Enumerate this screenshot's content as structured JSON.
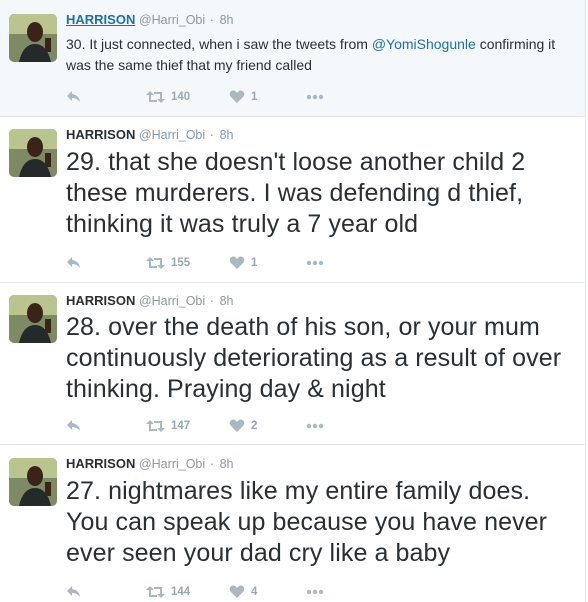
{
  "colors": {
    "accent": "#1b6fb0",
    "muted": "#8899a6",
    "icon": "#aab8c2",
    "border": "#e1e8ed"
  },
  "icons": {
    "reply": "reply-icon",
    "retweet": "retweet-icon",
    "like": "heart-icon",
    "more": "more-icon"
  },
  "tweets": [
    {
      "name": "HARRISON",
      "handle": "@Harri_Obi",
      "sep": "·",
      "time": "8h",
      "text_before": "30. It just connected, when i saw the tweets from ",
      "mention": "@YomiShogunle",
      "text_after": " confirming it was the same thief that my friend called",
      "retweets": "140",
      "likes": "1"
    },
    {
      "name": "HARRISON",
      "handle": "@Harri_Obi",
      "sep": "·",
      "time": "8h",
      "text": "29. that she doesn't loose another child 2 these murderers. I was defending d thief, thinking it was truly a 7 year old",
      "retweets": "155",
      "likes": "1"
    },
    {
      "name": "HARRISON",
      "handle": "@Harri_Obi",
      "sep": "·",
      "time": "8h",
      "text": "28. over the death of his son, or your mum continuously deteriorating as a result of over thinking. Praying day & night",
      "retweets": "147",
      "likes": "2"
    },
    {
      "name": "HARRISON",
      "handle": "@Harri_Obi",
      "sep": "·",
      "time": "8h",
      "text": "27. nightmares like my entire family does. You can speak up because you have never ever seen your dad cry like a baby",
      "retweets": "144",
      "likes": "4"
    }
  ]
}
